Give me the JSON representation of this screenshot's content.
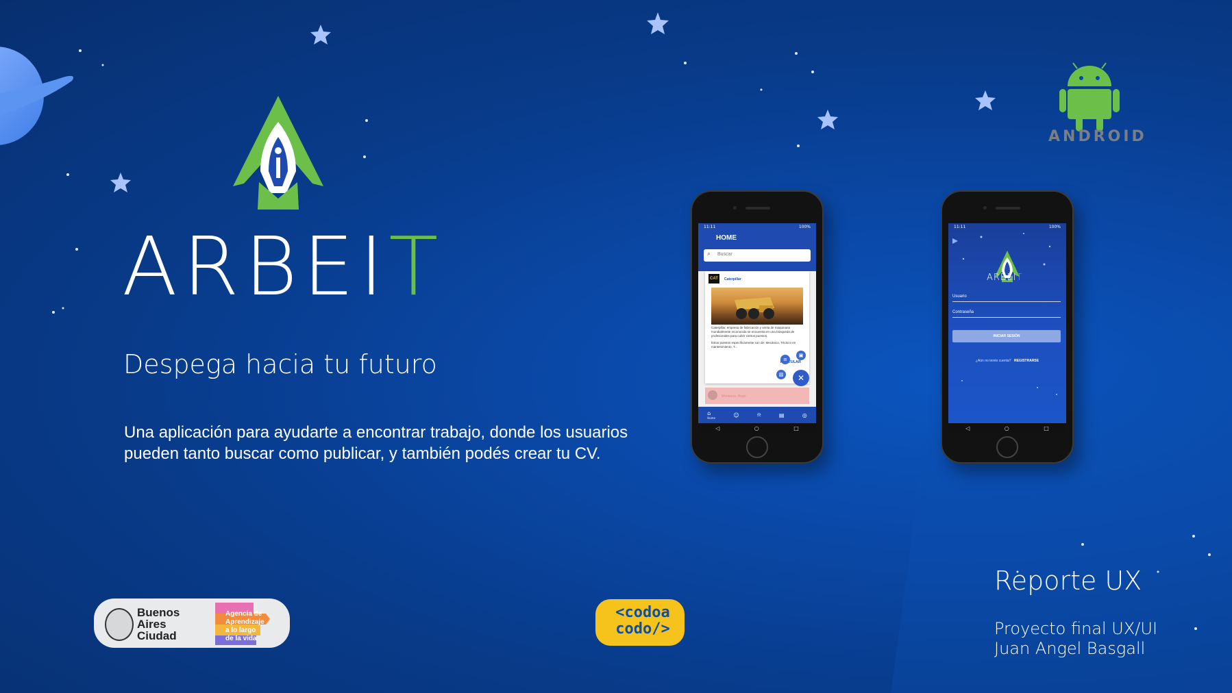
{
  "brand": {
    "name_main": "ARBEI",
    "name_accent": "T",
    "tagline": "Despega hacia tu futuro",
    "description": "Una aplicación para ayudarte a encontrar trabajo, donde los usuarios pueden tanto buscar como publicar, y también podés crear tu CV.",
    "accent_color": "#6cc04a"
  },
  "report": {
    "title": "Reporte UX",
    "subtitle_line1": "Proyecto final UX/UI",
    "subtitle_line2": "Juan Angel Basgall"
  },
  "logos": {
    "ba_line1": "Buenos",
    "ba_line2": "Aires",
    "ba_line3": "Ciudad",
    "agencia_line1": "Agencia de",
    "agencia_line2": "Aprendizaje",
    "agencia_line3": "a lo largo",
    "agencia_line4": "de la vida",
    "codo_line1": "<codoa",
    "codo_line2": "codo/>",
    "android_label": "ANDROID"
  },
  "phone_home": {
    "time": "11:11",
    "battery": "100%",
    "title": "HOME",
    "search_placeholder": "Buscar",
    "search_icon": "search-icon",
    "company_logo": "CAT",
    "company_name": "Caterpillar",
    "post_text_1": "Caterpillar, empresa de fabricación y venta de maquinaria mundialmente reconocida se encuentra en una búsqueda de profesionales para cubrir ciertos puestos.",
    "post_text_2": "Estos puestos específicamente son de: Mecánico, Técnico en mantenimiento, T...",
    "postular": "POSTULAR",
    "second_post_name": "Monteros, Hugo",
    "nav_home": "Home",
    "nav_icons": [
      "home-icon",
      "people-icon",
      "bell-icon",
      "briefcase-icon",
      "profile-icon"
    ],
    "primary_color": "#1f4bb0"
  },
  "phone_login": {
    "time": "11:11",
    "battery": "100%",
    "app_name_main": "ARBEI",
    "app_name_accent": "T",
    "user_label": "Usuario",
    "password_label": "Contraseña",
    "login_button": "INICIAR SESIÓN",
    "no_account": "¿Aún no tenés cuenta?",
    "register": "REGISTRARSE"
  }
}
